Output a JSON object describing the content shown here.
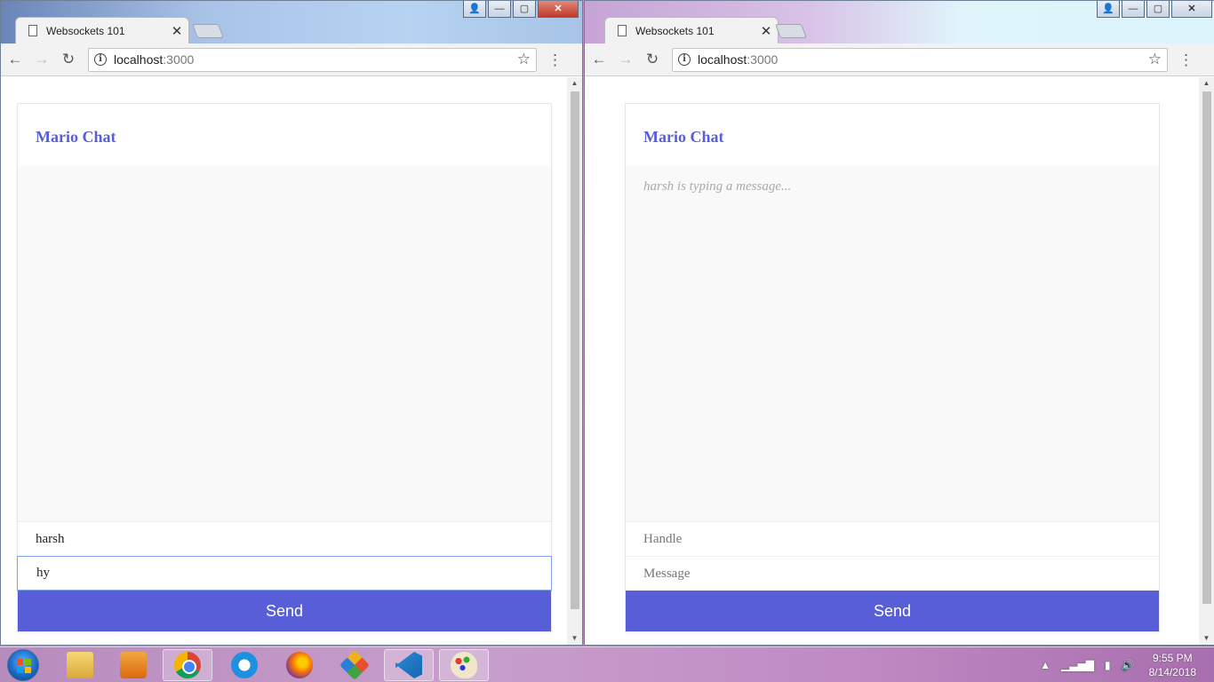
{
  "windows": [
    {
      "tab_title": "Websockets 101",
      "url_host": "localhost",
      "url_port": ":3000",
      "chat": {
        "title": "Mario Chat",
        "feedback": "",
        "handle_value": "harsh",
        "message_value": "hy",
        "send_label": "Send"
      }
    },
    {
      "tab_title": "Websockets 101",
      "url_host": "localhost",
      "url_port": ":3000",
      "chat": {
        "title": "Mario Chat",
        "feedback": "harsh is typing a message...",
        "handle_placeholder": "Handle",
        "message_placeholder": "Message",
        "send_label": "Send"
      }
    }
  ],
  "taskbar": {
    "apps": [
      "file-explorer",
      "media-player",
      "chrome",
      "internet-explorer",
      "firefox",
      "git",
      "vscode",
      "paint"
    ],
    "clock_time": "9:55 PM",
    "clock_date": "8/14/2018"
  },
  "colors": {
    "accent": "#575ed8",
    "chat_bg": "#f9f9f9",
    "feedback": "#aaaaaa"
  }
}
